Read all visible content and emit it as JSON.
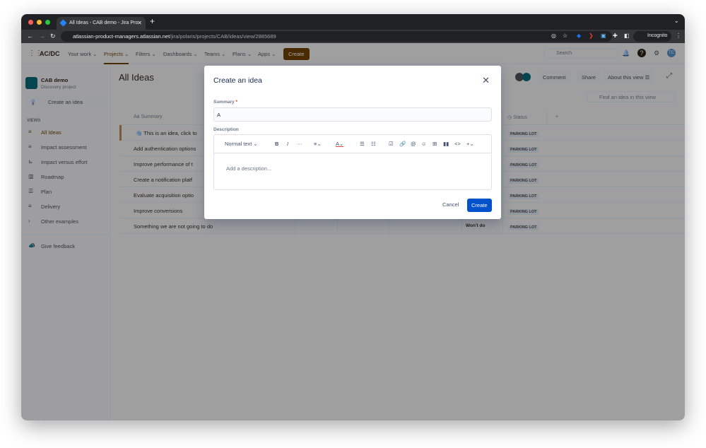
{
  "browser": {
    "tab_title": "All Ideas - CAB demo - Jira Pro",
    "url_host": "atlassian-product-managers.atlassian.net",
    "url_path": "/jira/polaris/projects/CAB/ideas/view/2885689",
    "profile": "Incognito"
  },
  "nav": {
    "logo": "AC/DC",
    "items": [
      "Your work ⌄",
      "Projects ⌄",
      "Filters ⌄",
      "Dashboards ⌄",
      "Teams ⌄",
      "Plans ⌄",
      "Apps ⌄"
    ],
    "create": "Create",
    "search_placeholder": "Search",
    "avatar": "TC"
  },
  "sidebar": {
    "project_name": "CAB demo",
    "project_type": "Discovery project",
    "create_idea": "Create an idea",
    "views_heading": "VIEWS",
    "items": [
      {
        "label": "All Ideas",
        "icon": "≡"
      },
      {
        "label": "Impact assessment",
        "icon": "≡"
      },
      {
        "label": "Impact versus effort",
        "icon": "⊾"
      },
      {
        "label": "Roadmap",
        "icon": "▥"
      },
      {
        "label": "Plan",
        "icon": "☰"
      },
      {
        "label": "Delivery",
        "icon": "≡"
      },
      {
        "label": "Other examples",
        "icon": "›"
      }
    ],
    "feedback": "Give feedback"
  },
  "main": {
    "title": "All Ideas",
    "comment": "Comment",
    "share": "Share",
    "about": "About this view ☰",
    "find_placeholder": "Find an idea in this view",
    "col_summary": "Summary",
    "col_status": "Status",
    "rows": [
      {
        "summary": "👋 This is an idea, click to",
        "extra": "",
        "status": "PARKING LOT"
      },
      {
        "summary": "Add authentication options",
        "extra": "",
        "status": "PARKING LOT"
      },
      {
        "summary": "Improve performance of t",
        "extra": "",
        "status": "PARKING LOT"
      },
      {
        "summary": "Create a notification platf",
        "extra": "",
        "status": "PARKING LOT"
      },
      {
        "summary": "Evaluate acquisition optio",
        "extra": "",
        "status": "PARKING LOT"
      },
      {
        "summary": "Improve conversions",
        "extra": "",
        "status": "PARKING LOT"
      },
      {
        "summary": "Something we are not going to do",
        "extra": "Won't do",
        "status": "PARKING LOT"
      }
    ]
  },
  "modal": {
    "title": "Create an idea",
    "summary_label": "Summary",
    "summary_value": "A",
    "description_label": "Description",
    "text_style": "Normal text ⌄",
    "description_placeholder": "Add a description...",
    "cancel": "Cancel",
    "create": "Create"
  },
  "colors": {
    "accent": "#0052cc",
    "overlay": "rgba(9,30,66,0.54)"
  }
}
